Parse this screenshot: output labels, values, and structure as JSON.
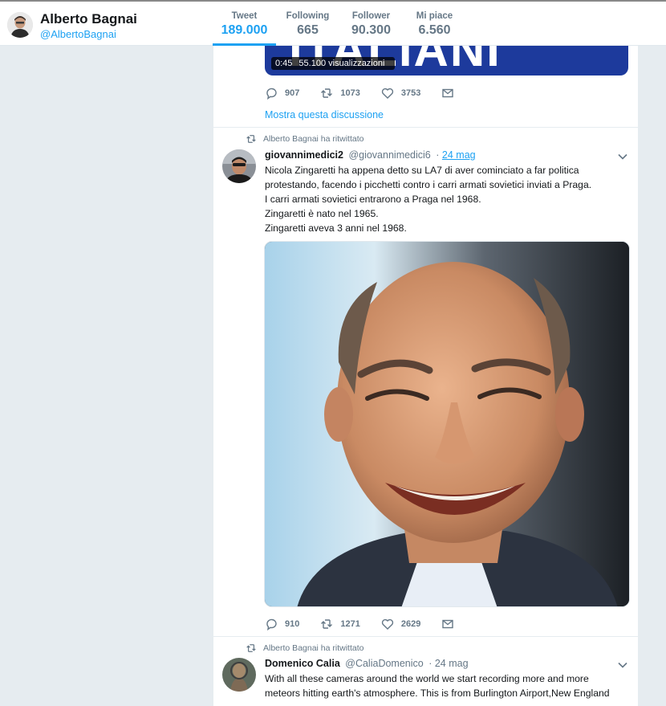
{
  "profile": {
    "name": "Alberto Bagnai",
    "handle": "@AlbertoBagnai"
  },
  "stats": [
    {
      "label": "Tweet",
      "value": "189.000",
      "active": true
    },
    {
      "label": "Following",
      "value": "665",
      "active": false
    },
    {
      "label": "Follower",
      "value": "90.300",
      "active": false
    },
    {
      "label": "Mi piace",
      "value": "6.560",
      "active": false
    }
  ],
  "video": {
    "overlay_text": "ITALIANI",
    "duration": "0:45",
    "views": "55.100 visualizzazioni"
  },
  "tweet1_actions": {
    "replies": "907",
    "retweets": "1073",
    "likes": "3753"
  },
  "show_thread_label": "Mostra questa discussione",
  "tweet2": {
    "retweeted_by": "Alberto Bagnai ha ritwittato",
    "name": "giovannimedici2",
    "handle": "@giovannimedici6",
    "sep": "·",
    "date": "24 mag",
    "lines": [
      "Nicola Zingaretti ha appena detto su LA7 di aver cominciato a far politica",
      "protestando, facendo i picchetti contro i carri armati sovietici inviati a Praga.",
      "I carri armati sovietici entrarono a Praga nel 1968.",
      "Zingaretti è nato nel 1965.",
      "Zingaretti aveva 3 anni nel 1968."
    ],
    "actions": {
      "replies": "910",
      "retweets": "1271",
      "likes": "2629"
    }
  },
  "tweet3": {
    "retweeted_by": "Alberto Bagnai ha ritwittato",
    "name": "Domenico Calia",
    "handle": "@CaliaDomenico",
    "sep": "·",
    "date": "24 mag",
    "lines": [
      "With all these cameras around the world we start recording more and more",
      "meteors hitting earth's atmosphere. This is from Burlington Airport,New England"
    ]
  },
  "icons": {
    "reply": "reply-icon",
    "retweet": "retweet-icon",
    "like": "heart-icon",
    "message": "envelope-icon",
    "caret": "chevron-down-icon"
  },
  "colors": {
    "accent": "#1da1f2",
    "muted": "#657786",
    "background": "#e6ecf0",
    "video_blue": "#1d3a9c"
  }
}
